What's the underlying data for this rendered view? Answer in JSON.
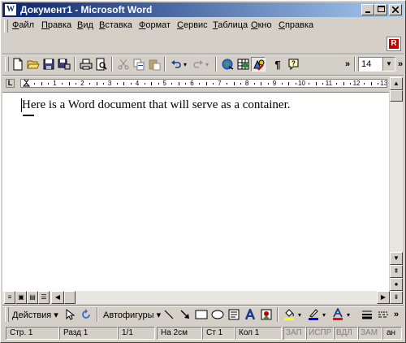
{
  "window": {
    "title": "Документ1 - Microsoft Word",
    "app_icon_letter": "W",
    "minimize_icon": "minimize-icon",
    "maximize_icon": "maximize-icon",
    "close_icon": "close-icon"
  },
  "menubar": {
    "items": [
      {
        "label": "Файл",
        "ul": "Ф",
        "rest": "айл"
      },
      {
        "label": "Правка",
        "ul": "П",
        "rest": "равка"
      },
      {
        "label": "Вид",
        "ul": "В",
        "rest": "ид"
      },
      {
        "label": "Вставка",
        "ul": "В",
        "rest": "ставка"
      },
      {
        "label": "Формат",
        "ul": "Ф",
        "rest": "ормат"
      },
      {
        "label": "Сервис",
        "ul": "С",
        "rest": "ервис"
      },
      {
        "label": "Таблица",
        "ul": "Т",
        "rest": "аблица"
      },
      {
        "label": "Окно",
        "ul": "О",
        "rest": "кно"
      },
      {
        "label": "Справка",
        "ul": "С",
        "rest": "правка"
      }
    ],
    "doc_icon_letter": "R"
  },
  "toolbar": {
    "font_size": "14",
    "pilcrow": "¶",
    "more": "»",
    "undo_arrow": "▾"
  },
  "ruler": {
    "numbers": [
      "1",
      "2",
      "3",
      "4",
      "5",
      "6",
      "7",
      "8",
      "9",
      "10",
      "11",
      "12",
      "13"
    ],
    "tab_selector": "L"
  },
  "document": {
    "text": "Here is a Word document that will serve as a container."
  },
  "drawing": {
    "actions_label": "Действия",
    "autoshapes_label": "Автофигуры"
  },
  "status": {
    "page": "Стр. 1",
    "section": "Разд 1",
    "pages": "1/1",
    "at": "На 2см",
    "line": "Ст 1",
    "col": "Кол 1",
    "rec": "ЗАП",
    "trk": "ИСПР",
    "ext": "ВДЛ",
    "ovr": "ЗАМ",
    "lang": "ан"
  },
  "colors": {
    "title_start": "#0a246a",
    "title_end": "#a6caf0",
    "highlight": "#ffff00",
    "font_color": "#ff0000",
    "line_color": "#0000ff",
    "face": "#d4d0c8"
  }
}
